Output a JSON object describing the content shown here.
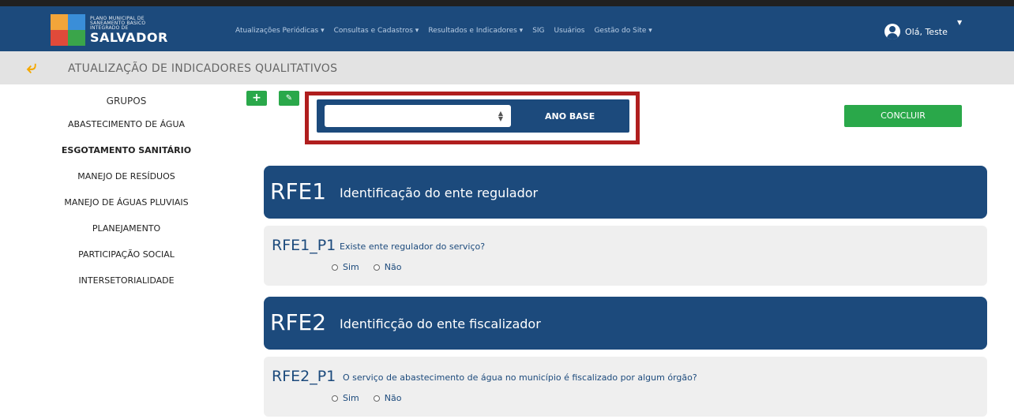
{
  "header": {
    "logo": {
      "small_lines": [
        "PLANO MUNICIPAL DE",
        "SANEAMENTO BÁSICO",
        "INTEGRADO DE"
      ],
      "city": "SALVADOR"
    },
    "menu": [
      "Atualizações Periódicas ▾",
      "Consultas e Cadastros ▾",
      "Resultados e Indicadores ▾",
      "SIG",
      "Usuários",
      "Gestão do Site ▾"
    ],
    "user_greeting": "Olá, Teste"
  },
  "titlebar": {
    "title": "ATUALIZAÇÃO DE INDICADORES QUALITATIVOS"
  },
  "sidebar": {
    "heading": "GRUPOS",
    "groups": [
      "ABASTECIMENTO DE ÁGUA",
      "ESGOTAMENTO SANITÁRIO",
      "MANEJO DE RESÍDUOS",
      "MANEJO DE ÁGUAS PLUVIAIS",
      "PLANEJAMENTO",
      "PARTICIPAÇÃO SOCIAL",
      "INTERSETORIALIDADE"
    ],
    "active_group": "ESGOTAMENTO SANITÁRIO"
  },
  "toolbar": {
    "add_label": "+",
    "edit_label": "✎"
  },
  "selector": {
    "value": "",
    "label": "ANO BASE"
  },
  "actions": {
    "conclude": "CONCLUIR"
  },
  "sections": [
    {
      "code": "RFE1",
      "title": "Identificação do ente regulador",
      "question_code": "RFE1_P1",
      "question": "Existe ente regulador do serviço?",
      "options": [
        "Sim",
        "Não"
      ]
    },
    {
      "code": "RFE2",
      "title": "Identificção do ente fiscalizador",
      "question_code": "RFE2_P1",
      "question": "O serviço de abastecimento de água no município é fiscalizado por algum órgão?",
      "options": [
        "Sim",
        "Não"
      ]
    }
  ],
  "colors": {
    "nav": "#1c4a7c",
    "accent_green": "#2aa84a",
    "highlight_red": "#b01e1e",
    "back_arrow": "#f5a800"
  }
}
